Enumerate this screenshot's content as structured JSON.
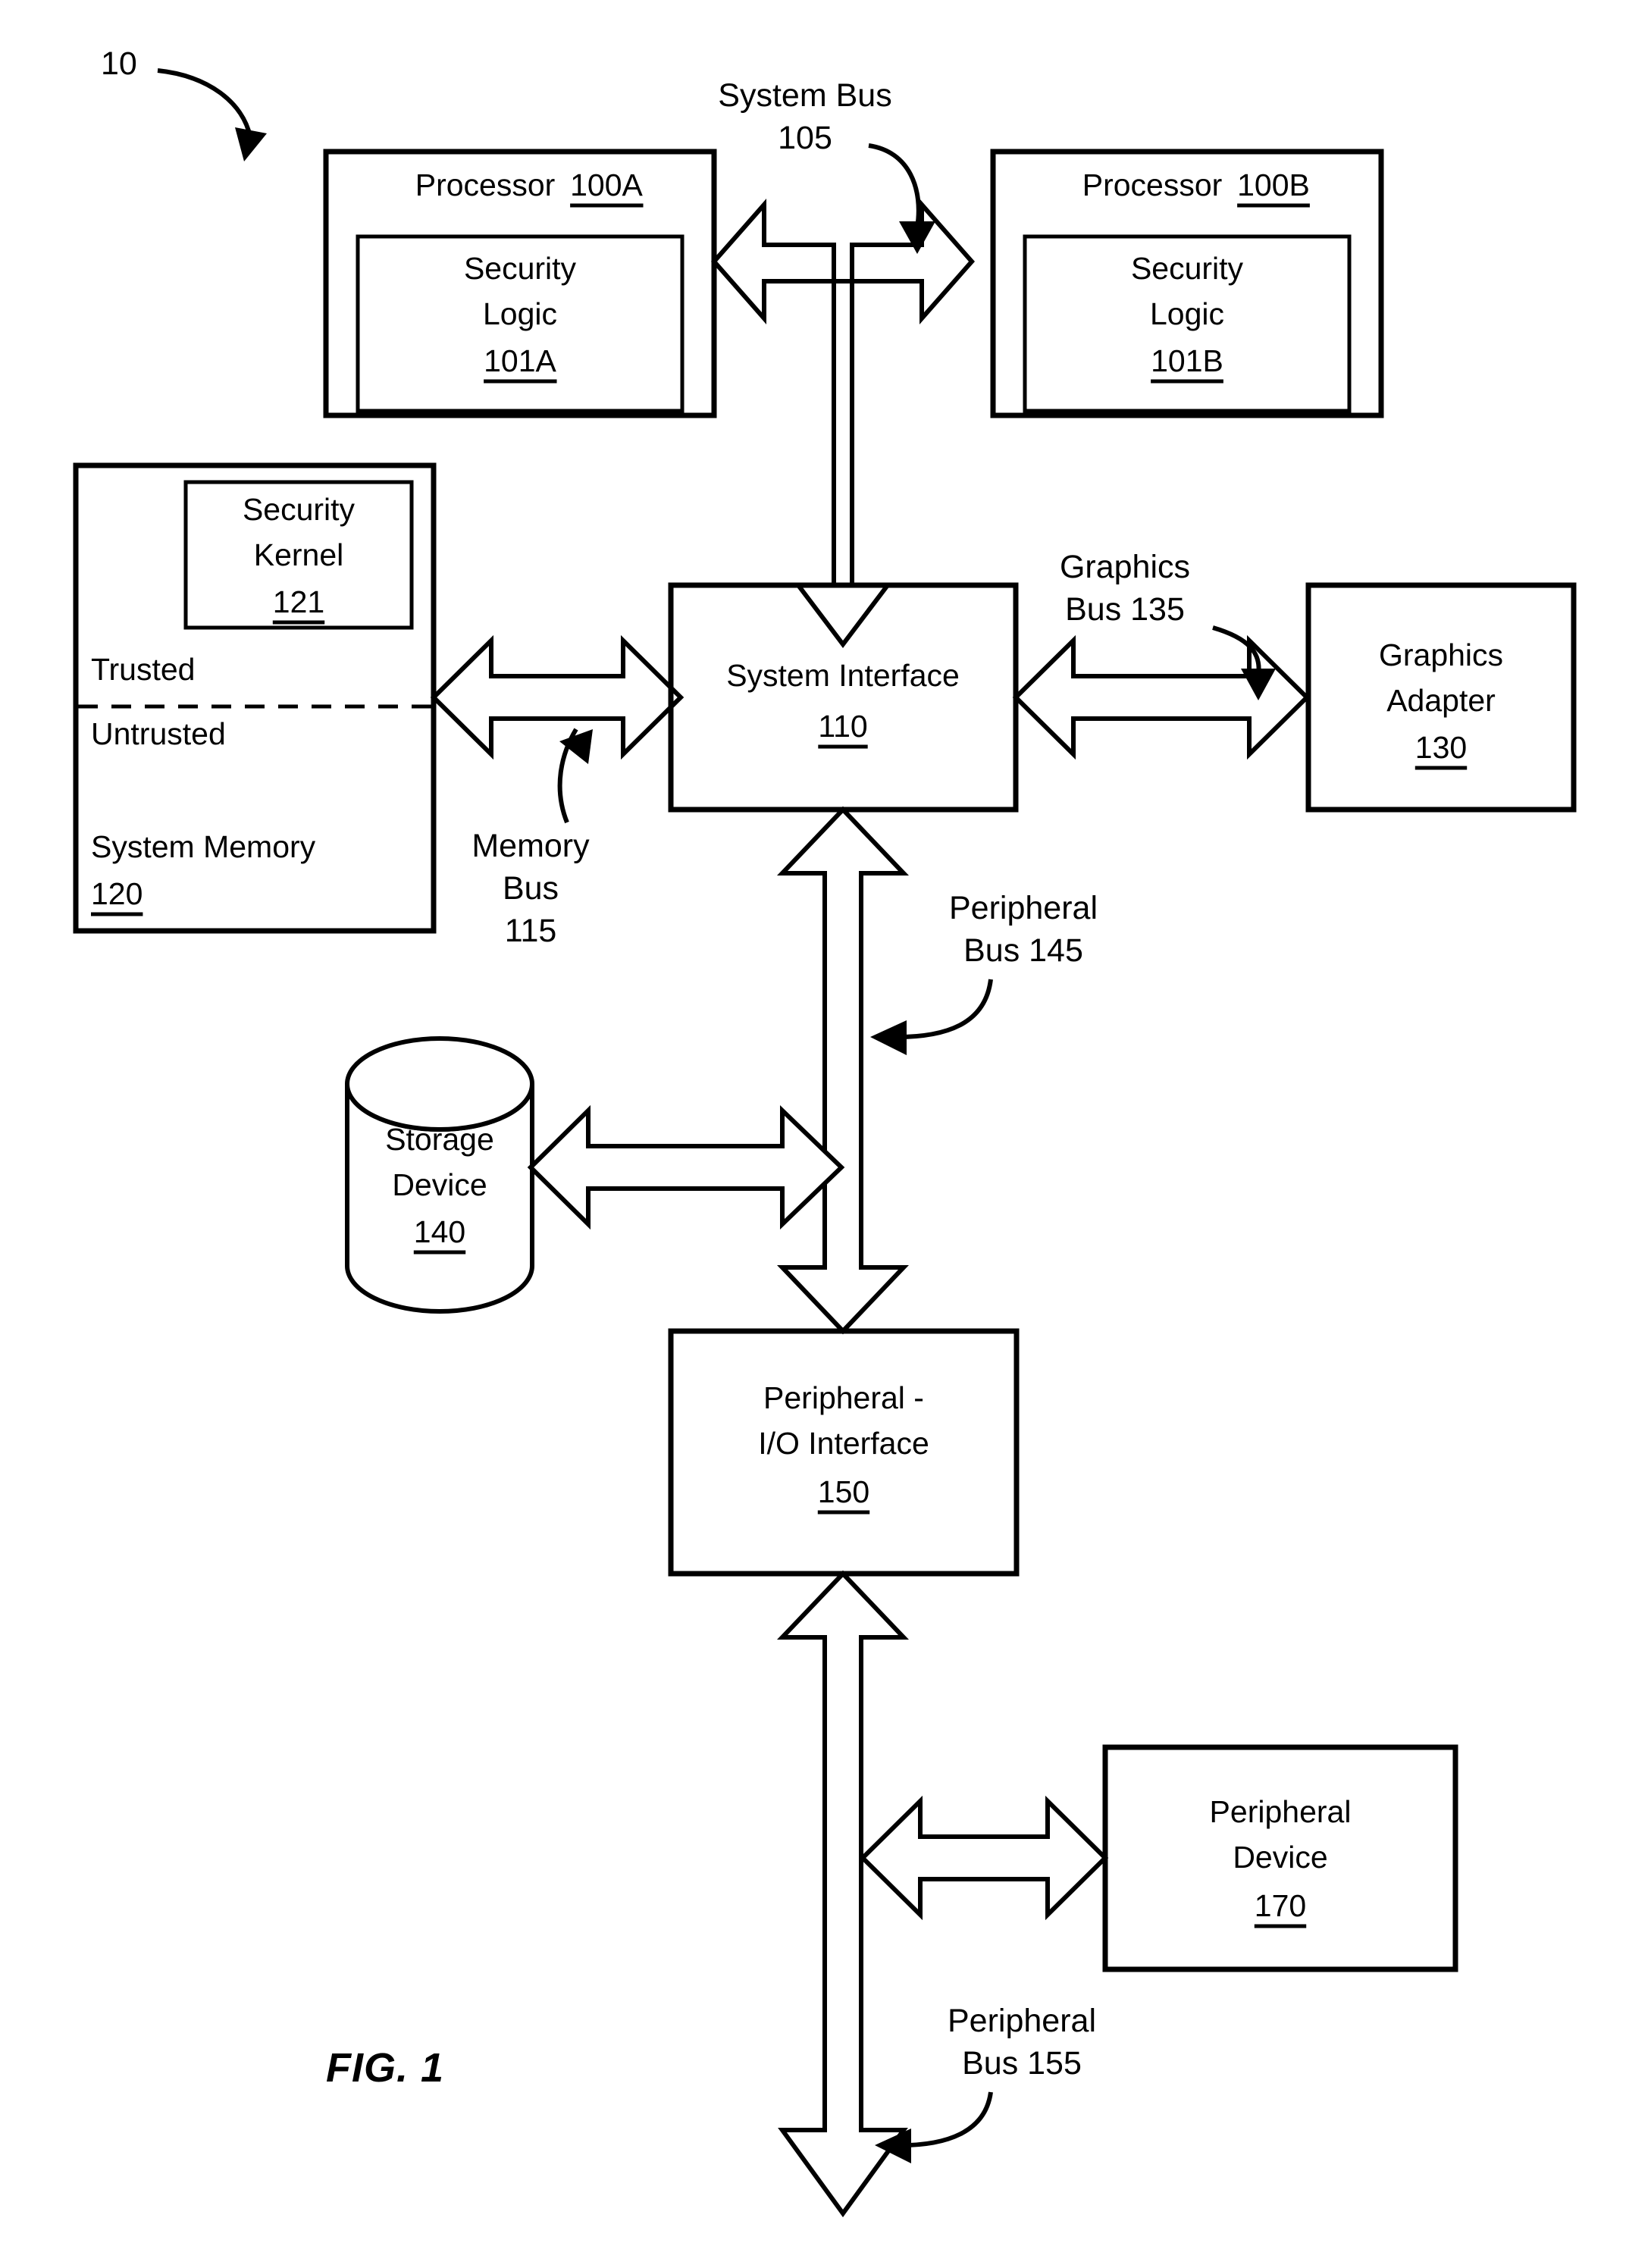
{
  "figure": {
    "caption": "FIG. 1",
    "system_ref": "10"
  },
  "blocks": {
    "processor_a": {
      "title": "Processor",
      "ref": "100A",
      "inner": {
        "line1": "Security",
        "line2": "Logic",
        "ref": "101A"
      }
    },
    "processor_b": {
      "title": "Processor",
      "ref": "100B",
      "inner": {
        "line1": "Security",
        "line2": "Logic",
        "ref": "101B"
      }
    },
    "system_memory": {
      "title": "System Memory",
      "ref": "120",
      "trusted_label": "Trusted",
      "untrusted_label": "Untrusted",
      "inner": {
        "line1": "Security",
        "line2": "Kernel",
        "ref": "121"
      }
    },
    "system_interface": {
      "title": "System Interface",
      "ref": "110"
    },
    "graphics_adapter": {
      "line1": "Graphics",
      "line2": "Adapter",
      "ref": "130"
    },
    "storage_device": {
      "line1": "Storage",
      "line2": "Device",
      "ref": "140"
    },
    "peripheral_io_interface": {
      "line1": "Peripheral -",
      "line2": "I/O Interface",
      "ref": "150"
    },
    "peripheral_device": {
      "line1": "Peripheral",
      "line2": "Device",
      "ref": "170"
    }
  },
  "buses": {
    "system_bus": {
      "line1": "System Bus",
      "line2": "105"
    },
    "memory_bus": {
      "line1": "Memory",
      "line2": "Bus",
      "line3": "115"
    },
    "graphics_bus": {
      "line1": "Graphics",
      "line2": "Bus 135"
    },
    "peripheral_bus_145": {
      "line1": "Peripheral",
      "line2": "Bus 145"
    },
    "peripheral_bus_155": {
      "line1": "Peripheral",
      "line2": "Bus 155"
    }
  },
  "colors": {
    "ink": "#000000",
    "paper": "#ffffff"
  }
}
